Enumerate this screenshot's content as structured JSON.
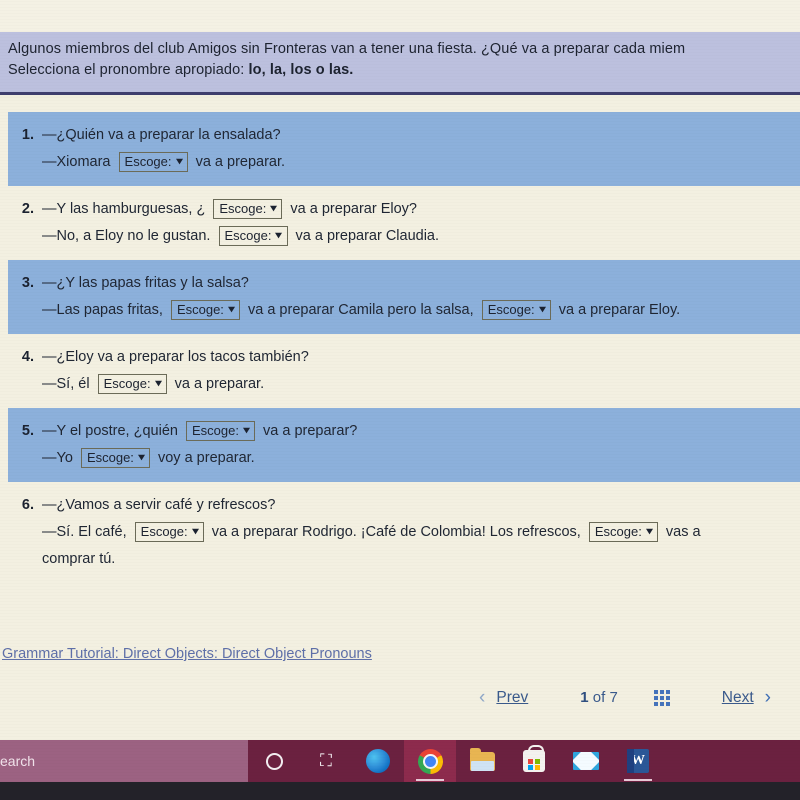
{
  "header": {
    "line1_pre": "Algunos miembros del club Amigos sin Fronteras van a tener una fiesta. ¿Qué va a preparar cada miem",
    "line2_pre": "Selecciona el pronombre apropiado: ",
    "line2_bold": "lo, la, los o las."
  },
  "dropdown": {
    "label": "Escoge:",
    "chevron": "⌄"
  },
  "questions": [
    {
      "number": "1.",
      "shaded": true,
      "lines": [
        {
          "indent": false,
          "parts": [
            {
              "t": "text",
              "v": "—¿Quién va a preparar la ensalada?"
            }
          ]
        },
        {
          "indent": true,
          "parts": [
            {
              "t": "text",
              "v": "—Xiomara"
            },
            {
              "t": "select"
            },
            {
              "t": "text",
              "v": "va a preparar."
            }
          ]
        }
      ]
    },
    {
      "number": "2.",
      "shaded": false,
      "lines": [
        {
          "indent": false,
          "parts": [
            {
              "t": "text",
              "v": "—Y las hamburguesas, ¿"
            },
            {
              "t": "select"
            },
            {
              "t": "text",
              "v": "va a preparar Eloy?"
            }
          ]
        },
        {
          "indent": true,
          "parts": [
            {
              "t": "text",
              "v": "—No, a Eloy no le gustan."
            },
            {
              "t": "select"
            },
            {
              "t": "text",
              "v": "va a preparar Claudia."
            }
          ]
        }
      ]
    },
    {
      "number": "3.",
      "shaded": true,
      "lines": [
        {
          "indent": false,
          "parts": [
            {
              "t": "text",
              "v": "—¿Y las papas fritas y la salsa?"
            }
          ]
        },
        {
          "indent": true,
          "parts": [
            {
              "t": "text",
              "v": "—Las papas fritas,"
            },
            {
              "t": "select"
            },
            {
              "t": "text",
              "v": "va a preparar Camila pero la salsa,"
            },
            {
              "t": "select"
            },
            {
              "t": "text",
              "v": "va a preparar Eloy."
            }
          ]
        }
      ]
    },
    {
      "number": "4.",
      "shaded": false,
      "lines": [
        {
          "indent": false,
          "parts": [
            {
              "t": "text",
              "v": "—¿Eloy va a preparar los tacos también?"
            }
          ]
        },
        {
          "indent": true,
          "parts": [
            {
              "t": "text",
              "v": "—Sí, él"
            },
            {
              "t": "select"
            },
            {
              "t": "text",
              "v": "va a preparar."
            }
          ]
        }
      ]
    },
    {
      "number": "5.",
      "shaded": true,
      "lines": [
        {
          "indent": false,
          "parts": [
            {
              "t": "text",
              "v": "—Y el postre, ¿quién"
            },
            {
              "t": "select"
            },
            {
              "t": "text",
              "v": "va a preparar?"
            }
          ]
        },
        {
          "indent": true,
          "parts": [
            {
              "t": "text",
              "v": "—Yo"
            },
            {
              "t": "select"
            },
            {
              "t": "text",
              "v": "voy a preparar."
            }
          ]
        }
      ]
    },
    {
      "number": "6.",
      "shaded": false,
      "lines": [
        {
          "indent": false,
          "parts": [
            {
              "t": "text",
              "v": "—¿Vamos a servir café y refrescos?"
            }
          ]
        },
        {
          "indent": true,
          "parts": [
            {
              "t": "text",
              "v": "—Sí. El café,"
            },
            {
              "t": "select"
            },
            {
              "t": "text",
              "v": "va a preparar Rodrigo. ¡Café de Colombia! Los refrescos,"
            },
            {
              "t": "select"
            },
            {
              "t": "text",
              "v": "vas a"
            }
          ]
        },
        {
          "indent": true,
          "parts": [
            {
              "t": "text",
              "v": "comprar tú."
            }
          ]
        }
      ]
    }
  ],
  "tutorial_link": "Grammar Tutorial: Direct Objects: Direct Object Pronouns",
  "pager": {
    "prev_chevron": "‹",
    "prev_label": "Prev",
    "current_page": "1",
    "of_word": "of",
    "total_pages": "7",
    "grid_icon": "grid-icon",
    "next_label": "Next",
    "next_chevron": "›"
  },
  "taskbar": {
    "search_text": "earch",
    "items": [
      {
        "name": "cortana-icon",
        "active": false
      },
      {
        "name": "task-view-icon",
        "active": false
      },
      {
        "name": "edge-icon",
        "active": false
      },
      {
        "name": "chrome-icon",
        "active": true
      },
      {
        "name": "file-explorer-icon",
        "active": false
      },
      {
        "name": "microsoft-store-icon",
        "active": false
      },
      {
        "name": "mail-icon",
        "active": false
      },
      {
        "name": "word-icon",
        "active": false
      }
    ],
    "task_view_glyph": "⛶"
  },
  "colors": {
    "header_band": "#bcc0de",
    "header_rule": "#3f3f6e",
    "row_shaded": "#8cb0db",
    "page_background": "#f3f0e1",
    "link": "#5e6fa8",
    "taskbar": "#6b2140",
    "taskbar_search": "#9c6282"
  }
}
